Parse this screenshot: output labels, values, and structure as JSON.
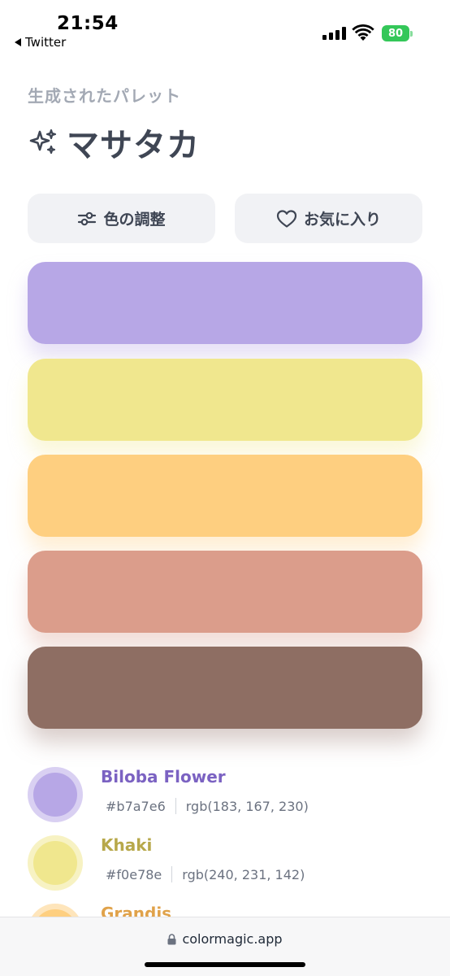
{
  "status": {
    "time": "21:54",
    "back_app": "Twitter",
    "battery": "80"
  },
  "header": {
    "subtitle": "生成されたパレット",
    "title": "マサタカ",
    "title_icon": "sparkles-icon"
  },
  "actions": {
    "adjust_label": "色の調整",
    "adjust_icon": "sliders-icon",
    "favorite_label": "お気に入り",
    "favorite_icon": "heart-icon"
  },
  "palette": [
    {
      "hex": "#b7a7e6"
    },
    {
      "hex": "#f0e78e"
    },
    {
      "hex": "#fecf80"
    },
    {
      "hex": "#db9d8b"
    },
    {
      "hex": "#8e6e63"
    }
  ],
  "colors": [
    {
      "name": "Biloba Flower",
      "hex": "#b7a7e6",
      "rgb": "rgb(183, 167, 230)",
      "name_color": "#7b62c2"
    },
    {
      "name": "Khaki",
      "hex": "#f0e78e",
      "rgb": "rgb(240, 231, 142)",
      "name_color": "#b7a84a"
    },
    {
      "name": "Grandis",
      "name_color": "#e0a24a",
      "swatch": "#fecf80"
    }
  ],
  "browser": {
    "url": "colormagic.app"
  }
}
